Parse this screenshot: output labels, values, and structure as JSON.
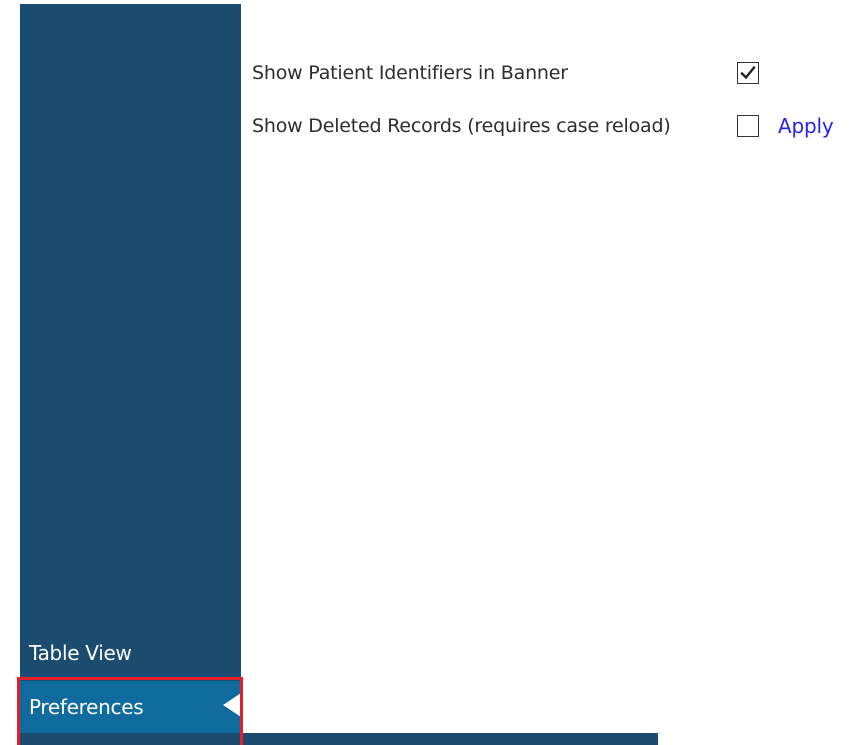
{
  "sidebar": {
    "items": [
      {
        "label": "Table View",
        "selected": false
      },
      {
        "label": "Preferences",
        "selected": true
      }
    ]
  },
  "preferences": {
    "show_patient_identifiers": {
      "label": "Show Patient Identifiers in Banner",
      "checked": true
    },
    "show_deleted_records": {
      "label": "Show Deleted Records (requires case reload)",
      "checked": false,
      "apply_label": "Apply"
    }
  },
  "colors": {
    "sidebar_background": "#1b4b6f",
    "selected_item_background": "#0f6a9e",
    "selection_outline": "#e21f2a",
    "link": "#2a1ef0"
  },
  "icons": {
    "checked": "checkmark-icon",
    "caret": "active-item-caret-icon"
  }
}
